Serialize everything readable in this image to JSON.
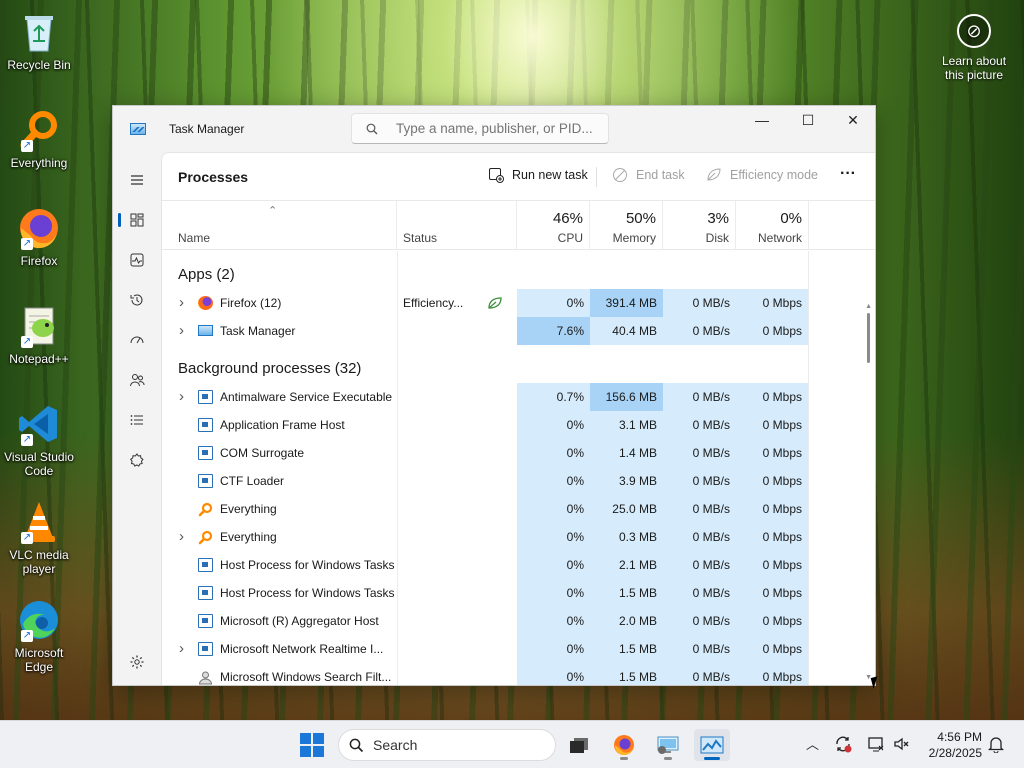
{
  "desktop": {
    "icons": [
      {
        "label": "Recycle Bin",
        "icon": "recycle-bin-icon"
      },
      {
        "label": "Everything",
        "icon": "everything-icon"
      },
      {
        "label": "Firefox",
        "icon": "firefox-icon"
      },
      {
        "label": "Notepad++",
        "icon": "notepadpp-icon"
      },
      {
        "label": "Visual Studio Code",
        "icon": "vscode-icon"
      },
      {
        "label": "VLC media player",
        "icon": "vlc-icon"
      },
      {
        "label": "Microsoft Edge",
        "icon": "edge-icon"
      }
    ],
    "learn_label": "Learn about this picture"
  },
  "window": {
    "title": "Task Manager",
    "search_placeholder": "Type a name, publisher, or PID...",
    "controls": {
      "minimize": "—",
      "maximize": "☐",
      "close": "✕"
    }
  },
  "toolbar": {
    "page_title": "Processes",
    "run_new_task": "Run new task",
    "end_task": "End task",
    "efficiency_mode": "Efficiency mode",
    "more": "···"
  },
  "columns": {
    "name": "Name",
    "status": "Status",
    "cpu": {
      "pct": "46%",
      "label": "CPU"
    },
    "memory": {
      "pct": "50%",
      "label": "Memory"
    },
    "disk": {
      "pct": "3%",
      "label": "Disk"
    },
    "network": {
      "pct": "0%",
      "label": "Network"
    }
  },
  "groups": {
    "apps": "Apps (2)",
    "background": "Background processes (32)"
  },
  "apps": [
    {
      "name": "Firefox (12)",
      "status": "Efficiency...",
      "cpu": "0%",
      "memory": "391.4 MB",
      "disk": "0 MB/s",
      "network": "0 Mbps",
      "expandable": true,
      "icon": "firefox"
    },
    {
      "name": "Task Manager",
      "status": "",
      "cpu": "7.6%",
      "memory": "40.4 MB",
      "disk": "0 MB/s",
      "network": "0 Mbps",
      "expandable": true,
      "icon": "taskmgr"
    }
  ],
  "background": [
    {
      "name": "Antimalware Service Executable",
      "cpu": "0.7%",
      "memory": "156.6 MB",
      "disk": "0 MB/s",
      "network": "0 Mbps",
      "expandable": true,
      "icon": "service"
    },
    {
      "name": "Application Frame Host",
      "cpu": "0%",
      "memory": "3.1 MB",
      "disk": "0 MB/s",
      "network": "0 Mbps",
      "expandable": false,
      "icon": "service"
    },
    {
      "name": "COM Surrogate",
      "cpu": "0%",
      "memory": "1.4 MB",
      "disk": "0 MB/s",
      "network": "0 Mbps",
      "expandable": false,
      "icon": "service"
    },
    {
      "name": "CTF Loader",
      "cpu": "0%",
      "memory": "3.9 MB",
      "disk": "0 MB/s",
      "network": "0 Mbps",
      "expandable": false,
      "icon": "service"
    },
    {
      "name": "Everything",
      "cpu": "0%",
      "memory": "25.0 MB",
      "disk": "0 MB/s",
      "network": "0 Mbps",
      "expandable": false,
      "icon": "everything"
    },
    {
      "name": "Everything",
      "cpu": "0%",
      "memory": "0.3 MB",
      "disk": "0 MB/s",
      "network": "0 Mbps",
      "expandable": true,
      "icon": "everything"
    },
    {
      "name": "Host Process for Windows Tasks",
      "cpu": "0%",
      "memory": "2.1 MB",
      "disk": "0 MB/s",
      "network": "0 Mbps",
      "expandable": false,
      "icon": "service"
    },
    {
      "name": "Host Process for Windows Tasks",
      "cpu": "0%",
      "memory": "1.5 MB",
      "disk": "0 MB/s",
      "network": "0 Mbps",
      "expandable": false,
      "icon": "service"
    },
    {
      "name": "Microsoft (R) Aggregator Host",
      "cpu": "0%",
      "memory": "2.0 MB",
      "disk": "0 MB/s",
      "network": "0 Mbps",
      "expandable": false,
      "icon": "service"
    },
    {
      "name": "Microsoft Network Realtime I...",
      "cpu": "0%",
      "memory": "1.5 MB",
      "disk": "0 MB/s",
      "network": "0 Mbps",
      "expandable": true,
      "icon": "service"
    },
    {
      "name": "Microsoft Windows Search Filt...",
      "cpu": "0%",
      "memory": "1.5 MB",
      "disk": "0 MB/s",
      "network": "0 Mbps",
      "expandable": false,
      "icon": "user"
    }
  ],
  "taskbar": {
    "search_label": "Search",
    "time": "4:56 PM",
    "date": "2/28/2025"
  },
  "colors": {
    "accent": "#005fb8",
    "highlight": "#d6ecfc",
    "highlight_strong": "#a8d3f6"
  }
}
